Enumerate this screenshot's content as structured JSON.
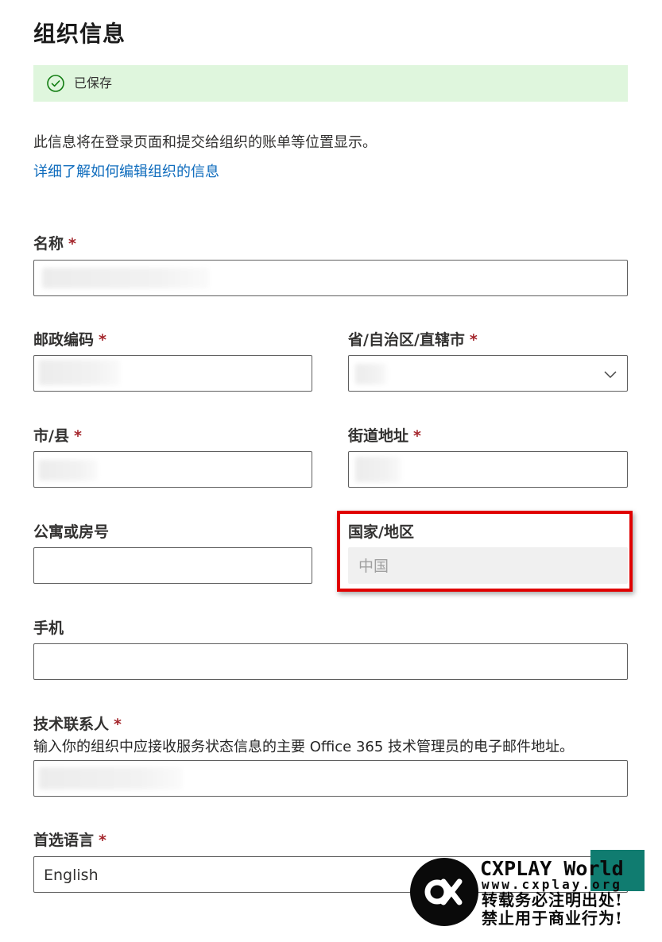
{
  "page": {
    "title": "组织信息",
    "saved_text": "已保存",
    "description": "此信息将在登录页面和提交给组织的账单等位置显示。",
    "learn_more_link": "详细了解如何编辑组织的信息"
  },
  "required_marker": "*",
  "fields": {
    "name": {
      "label": "名称",
      "required": true
    },
    "postal_code": {
      "label": "邮政编码",
      "required": true
    },
    "province": {
      "label": "省/自治区/直辖市",
      "required": true
    },
    "city": {
      "label": "市/县",
      "required": true
    },
    "street": {
      "label": "街道地址",
      "required": true
    },
    "apartment": {
      "label": "公寓或房号",
      "required": false,
      "value": ""
    },
    "country": {
      "label": "国家/地区",
      "value": "中国"
    },
    "phone": {
      "label": "手机",
      "required": false,
      "value": ""
    },
    "tech_contact": {
      "label": "技术联系人",
      "required": true,
      "helper": "输入你的组织中应接收服务状态信息的主要 Office 365 技术管理员的电子邮件地址。"
    },
    "language": {
      "label": "首选语言",
      "required": true,
      "value": "English"
    }
  },
  "watermark": {
    "brand": "CXPLAY World",
    "url": "www.cxplay.org",
    "line1": "转载务必注明出处!",
    "line2": "禁止用于商业行为!"
  },
  "colors": {
    "banner_bg": "#dff6dd",
    "success_icon": "#107c10",
    "link": "#0f6cbd",
    "required": "#a4262c",
    "highlight": "#e00000"
  },
  "icons": {
    "saved": "check-circle-icon",
    "province_dropdown": "chevron-down-icon",
    "watermark_logo": "cxplay-logo-icon"
  }
}
